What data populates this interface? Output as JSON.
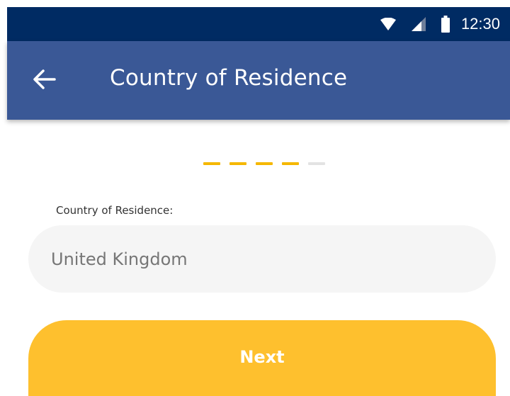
{
  "status_bar": {
    "time": "12:30",
    "icons": [
      "wifi-icon",
      "signal-icon",
      "battery-icon"
    ],
    "background": "#002b63"
  },
  "app_bar": {
    "title": "Country of Residence",
    "back_icon": "arrow-left-icon",
    "background": "#3a5896"
  },
  "progress": {
    "total_steps": 5,
    "current_step": 4,
    "active_color": "#f5b700",
    "inactive_color": "#e3e3e3"
  },
  "form": {
    "country_label": "Country of Residence:",
    "country_value": "United Kingdom",
    "field_background": "#f5f5f5"
  },
  "actions": {
    "next_label": "Next",
    "next_color": "#fec02e"
  }
}
